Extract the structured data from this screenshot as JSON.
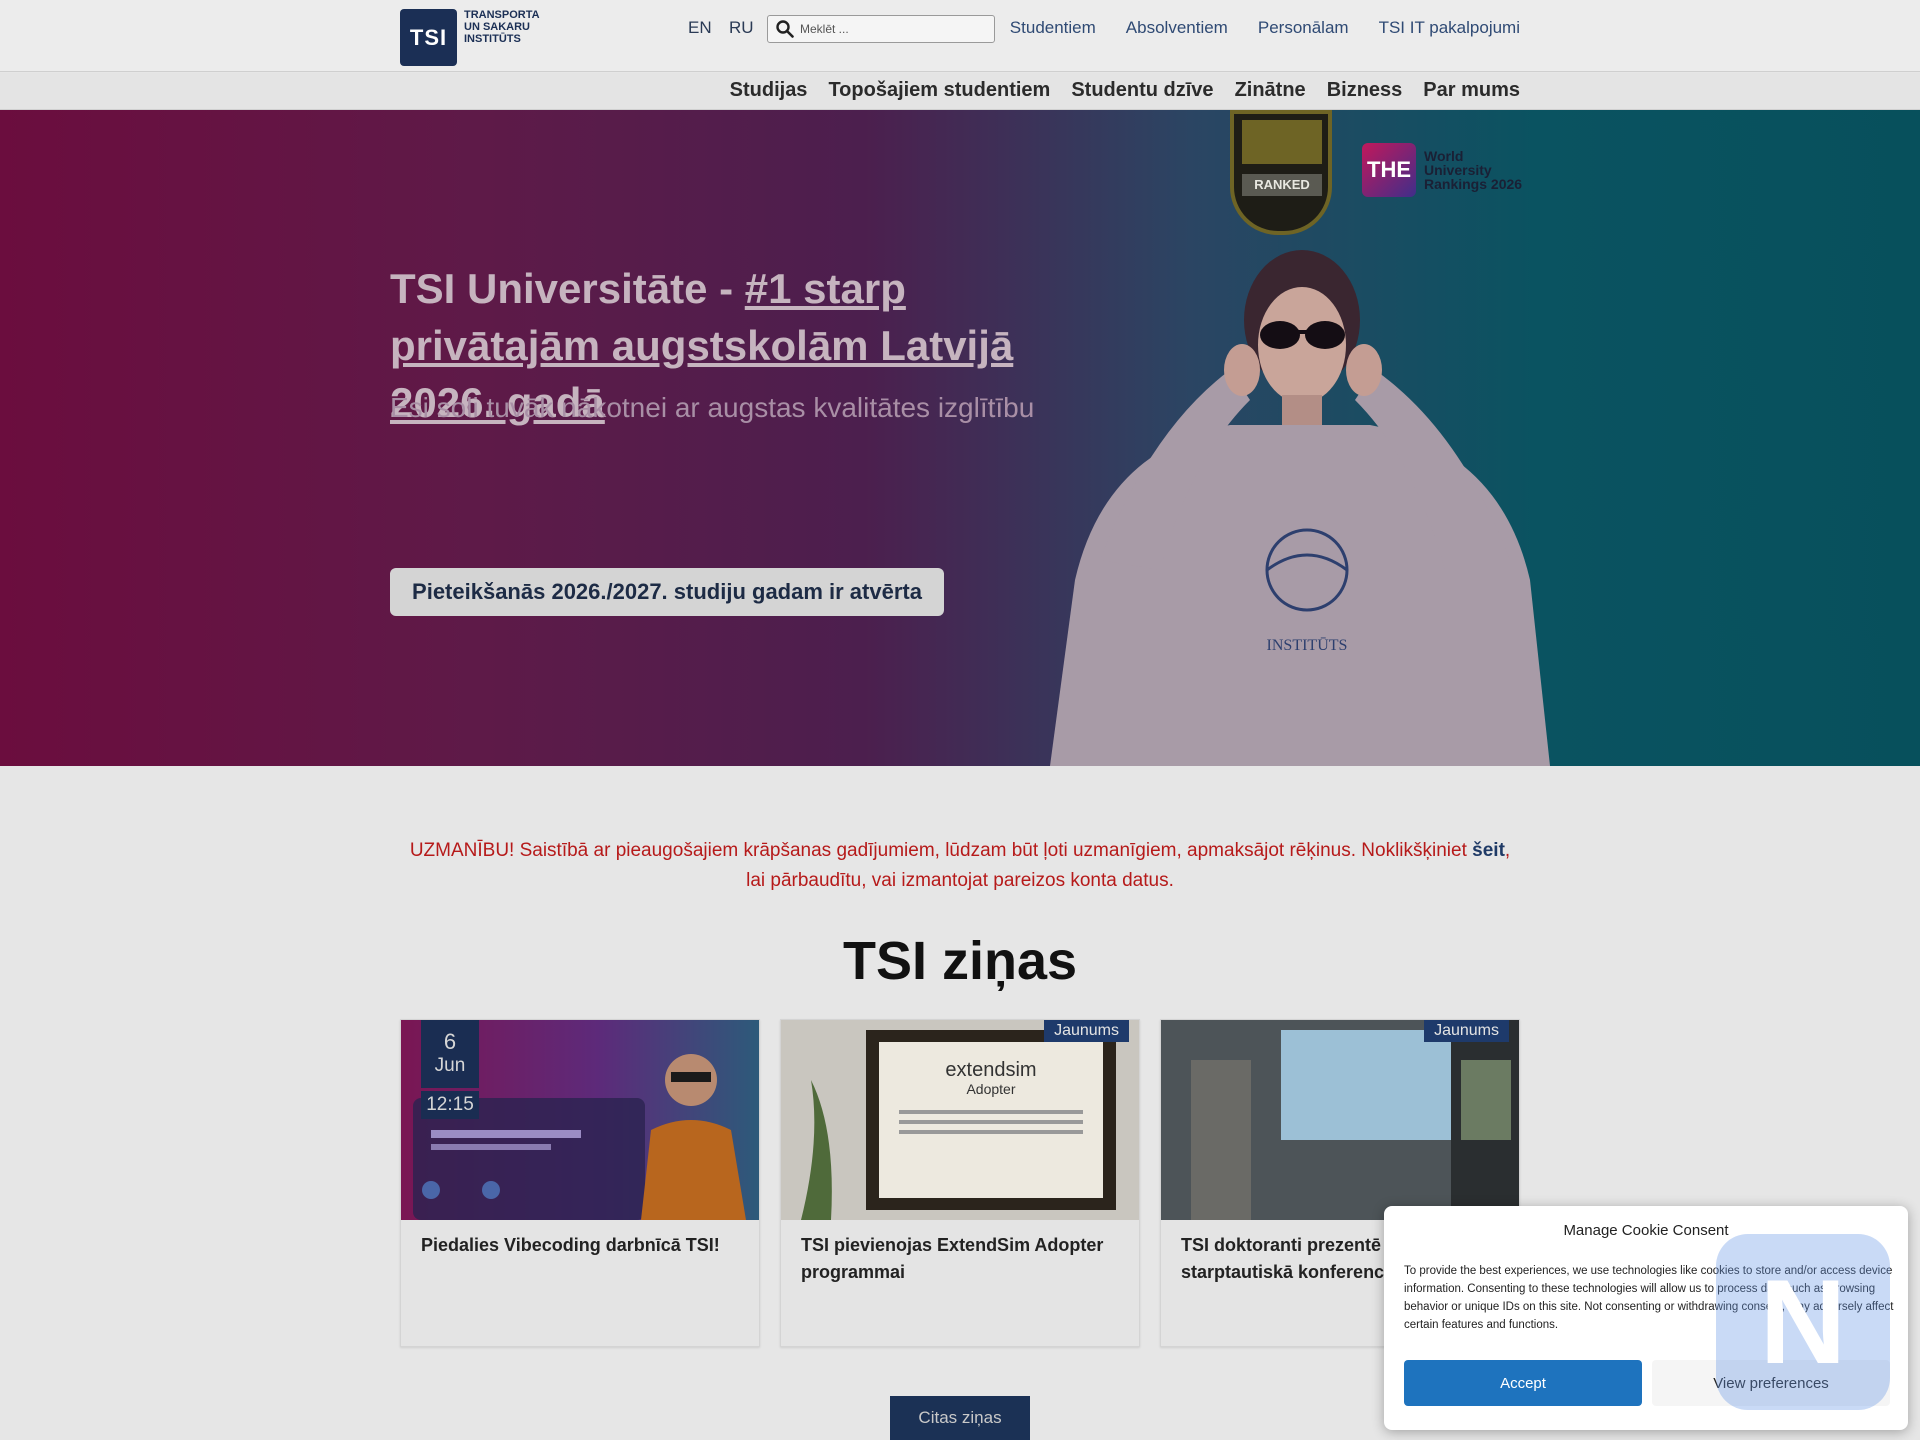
{
  "header": {
    "logo_mark": "TSI",
    "logo_lines": [
      "TRANSPORTA",
      "UN SAKARU",
      "INSTITŪTS"
    ],
    "lang_en": "EN",
    "lang_ru": "RU",
    "search_placeholder": "Meklēt ...",
    "top_links": [
      "Studentiem",
      "Absolventiem",
      "Personālam",
      "TSI IT pakalpojumi"
    ]
  },
  "nav": {
    "items": [
      "Studijas",
      "Topošajiem studentiem",
      "Studentu dzīve",
      "Zinātne",
      "Bizness",
      "Par mums"
    ]
  },
  "hero": {
    "title_plain": "TSI Universitāte - ",
    "title_link": "#1 starp privātajām augstskolām Latvijā 2026. gadā",
    "subtitle": "Esi soli tuvāk nākotnei ar augstas kvalitātes izglītību",
    "cta": "Pieteikšanās 2026./2027. studiju gadam ir atvērta",
    "badge_qs_ranked": "RANKED",
    "the_mark": "THE",
    "the_lines": [
      "World",
      "University",
      "Rankings 2026"
    ]
  },
  "notice": {
    "text_before": "UZMANĪBU! Saistībā ar pieaugošajiem krāpšanas gadījumiem, lūdzam būt ļoti uzmanīgiem, apmaksājot rēķinus. Noklikšķiniet ",
    "link": "šeit",
    "text_after": ", lai pārbaudītu, vai izmantojat pareizos konta datus."
  },
  "news": {
    "heading": "TSI ziņas",
    "cards": [
      {
        "title": "Piedalies Vibecoding darbnīcā TSI!",
        "day": "6",
        "month": "Jun",
        "time": "12:15"
      },
      {
        "title": "TSI pievienojas ExtendSim Adopter programmai",
        "tag": "Jaunums"
      },
      {
        "title": "TSI doktoranti prezentē sa starptautiskā konferencē",
        "tag": "Jaunums"
      }
    ],
    "more_button": "Citas ziņas"
  },
  "cookie": {
    "title": "Manage Cookie Consent",
    "body": "To provide the best experiences, we use technologies like cookies to store and/or access device information. Consenting to these technologies will allow us to process data such as browsing behavior or unique IDs on this site. Not consenting or withdrawing consent, may adversely affect certain features and functions.",
    "accept": "Accept",
    "preferences": "View preferences"
  },
  "colors": {
    "brand_navy": "#1b2f55",
    "notice_red": "#b61a1a",
    "accept_blue": "#1e73be"
  }
}
